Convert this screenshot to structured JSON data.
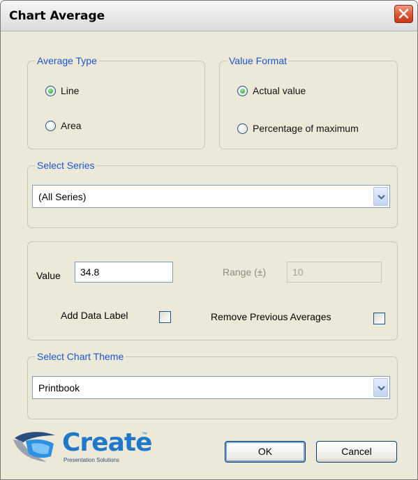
{
  "window": {
    "title": "Chart Average"
  },
  "average_type": {
    "legend": "Average Type",
    "options": [
      {
        "label": "Line",
        "checked": true
      },
      {
        "label": "Area",
        "checked": false
      }
    ]
  },
  "value_format": {
    "legend": "Value Format",
    "options": [
      {
        "label": "Actual value",
        "checked": true
      },
      {
        "label": "Percentage of maximum",
        "checked": false
      }
    ]
  },
  "select_series": {
    "legend": "Select Series",
    "selected": "(All Series)"
  },
  "value_group": {
    "value_label": "Value",
    "value": "34.8",
    "range_label": "Range (±)",
    "range_value": "10",
    "add_data_label": "Add Data Label",
    "add_data_label_checked": false,
    "remove_previous_label": "Remove Previous Averages",
    "remove_previous_checked": false
  },
  "chart_theme": {
    "legend": "Select Chart Theme",
    "selected": "Printbook"
  },
  "buttons": {
    "ok": "OK",
    "cancel": "Cancel"
  },
  "logo": {
    "word": "Create",
    "tm": "™",
    "subtitle": "Presentation Solutions"
  },
  "colors": {
    "legend_text": "#1b55d0",
    "dialog_bg": "#ece9d8",
    "logo_blue": "#2278c8",
    "close_red": "#d8542f"
  },
  "icons": {
    "close": "close-x-icon",
    "dropdown": "chevron-down-icon",
    "logo": "create-logo-icon"
  }
}
